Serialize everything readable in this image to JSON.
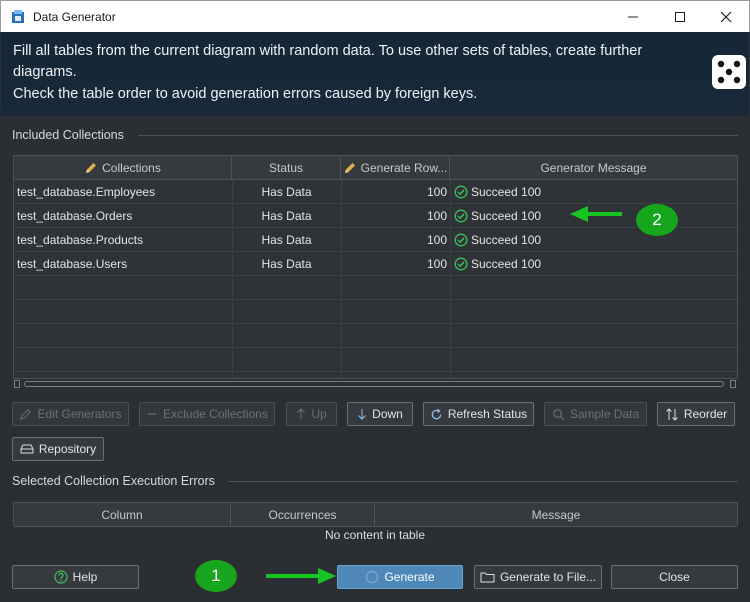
{
  "window": {
    "title": "Data Generator"
  },
  "banner": {
    "line1": "Fill all tables from the current diagram with random data. To use other sets of tables, create further",
    "line2": "diagrams.",
    "line3": "Check the table order to avoid generation errors caused by foreign keys."
  },
  "included": {
    "title": "Included Collections",
    "columns": {
      "collections": "Collections",
      "status": "Status",
      "generate_rows": "Generate Row...",
      "message": "Generator Message"
    },
    "rows": [
      {
        "name": "test_database.Employees",
        "status": "Has Data",
        "rows": "100",
        "message": "Succeed 100"
      },
      {
        "name": "test_database.Orders",
        "status": "Has Data",
        "rows": "100",
        "message": "Succeed 100"
      },
      {
        "name": "test_database.Products",
        "status": "Has Data",
        "rows": "100",
        "message": "Succeed 100"
      },
      {
        "name": "test_database.Users",
        "status": "Has Data",
        "rows": "100",
        "message": "Succeed 100"
      }
    ]
  },
  "toolbar": {
    "edit_generators": "Edit Generators",
    "exclude_collections": "Exclude Collections",
    "up": "Up",
    "down": "Down",
    "refresh_status": "Refresh Status",
    "sample_data": "Sample Data",
    "reorder": "Reorder",
    "repository": "Repository"
  },
  "errors": {
    "title": "Selected Collection Execution Errors",
    "columns": {
      "column": "Column",
      "occurrences": "Occurrences",
      "message": "Message"
    },
    "empty": "No content in table"
  },
  "footer": {
    "help": "Help",
    "generate": "Generate",
    "generate_to_file": "Generate to File...",
    "close": "Close"
  },
  "annotations": {
    "badge1": "1",
    "badge2": "2"
  },
  "colors": {
    "accent": "#4d88b8",
    "badge": "#16a51d",
    "success": "#3fbf5a",
    "banner": "#152737"
  }
}
